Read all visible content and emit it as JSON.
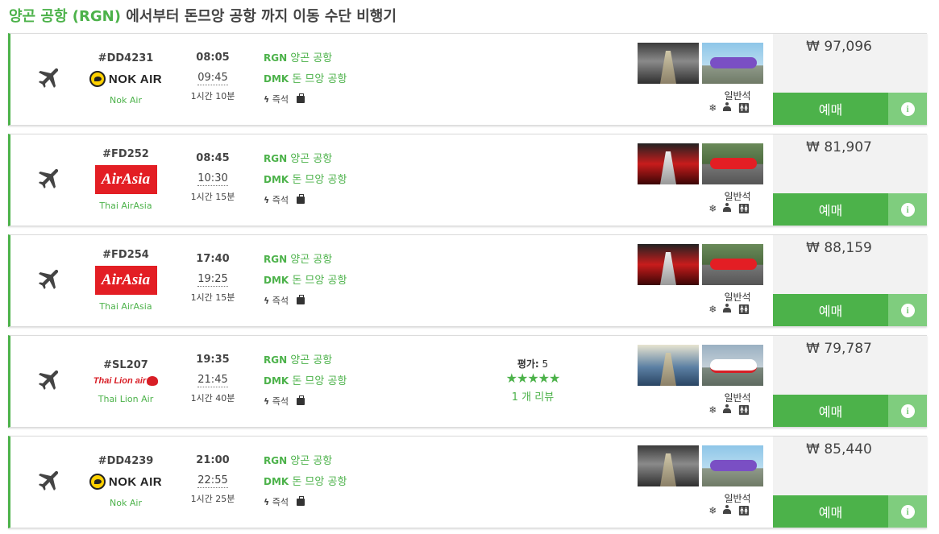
{
  "page": {
    "title_highlight": "양곤 공항 (RGN)",
    "title_rest": " 에서부터 돈므앙 공항 까지 이동 수단 비행기"
  },
  "colors": {
    "accent": "#4cb24a",
    "accent_light": "#7fcd7e",
    "price_bg": "#f2f2f2"
  },
  "flights": [
    {
      "flight_no": "#DD4231",
      "logo_text": "NOK AIR",
      "carrier": "Nok Air",
      "airline_style": "nok",
      "dep_time": "08:05",
      "arr_time": "09:45",
      "duration": "1시간 10분",
      "origin_code": "RGN",
      "origin_name": " 양곤 공항",
      "dest_code": "DMK",
      "dest_name": " 돈 므앙 공항",
      "amenity_label": "즉석",
      "cabin_class": "일반석",
      "price": "₩ 97,096",
      "book_label": "예매",
      "info_icon": "info-icon"
    },
    {
      "flight_no": "#FD252",
      "logo_text": "AirAsia",
      "carrier": "Thai AirAsia",
      "airline_style": "airasia",
      "dep_time": "08:45",
      "arr_time": "10:30",
      "duration": "1시간 15분",
      "origin_code": "RGN",
      "origin_name": " 양곤 공항",
      "dest_code": "DMK",
      "dest_name": " 돈 므앙 공항",
      "amenity_label": "즉석",
      "cabin_class": "일반석",
      "price": "₩ 81,907",
      "book_label": "예매",
      "info_icon": "info-icon"
    },
    {
      "flight_no": "#FD254",
      "logo_text": "AirAsia",
      "carrier": "Thai AirAsia",
      "airline_style": "airasia",
      "dep_time": "17:40",
      "arr_time": "19:25",
      "duration": "1시간 15분",
      "origin_code": "RGN",
      "origin_name": " 양곤 공항",
      "dest_code": "DMK",
      "dest_name": " 돈 므앙 공항",
      "amenity_label": "즉석",
      "cabin_class": "일반석",
      "price": "₩ 88,159",
      "book_label": "예매",
      "info_icon": "info-icon"
    },
    {
      "flight_no": "#SL207",
      "logo_text": "Thai Lion air",
      "carrier": "Thai Lion Air",
      "airline_style": "lion",
      "dep_time": "19:35",
      "arr_time": "21:45",
      "duration": "1시간 40분",
      "origin_code": "RGN",
      "origin_name": " 양곤 공항",
      "dest_code": "DMK",
      "dest_name": " 돈 므앙 공항",
      "amenity_label": "즉석",
      "cabin_class": "일반석",
      "price": "₩ 79,787",
      "book_label": "예매",
      "info_icon": "info-icon",
      "rating": {
        "label": "평가:",
        "score": "5",
        "stars": "★★★★★",
        "reviews": "1 개 리뷰"
      }
    },
    {
      "flight_no": "#DD4239",
      "logo_text": "NOK AIR",
      "carrier": "Nok Air",
      "airline_style": "nok",
      "dep_time": "21:00",
      "arr_time": "22:55",
      "duration": "1시간 25분",
      "origin_code": "RGN",
      "origin_name": " 양곤 공항",
      "dest_code": "DMK",
      "dest_name": " 돈 므앙 공항",
      "amenity_label": "즉석",
      "cabin_class": "일반석",
      "price": "₩ 85,440",
      "book_label": "예매",
      "info_icon": "info-icon"
    }
  ]
}
